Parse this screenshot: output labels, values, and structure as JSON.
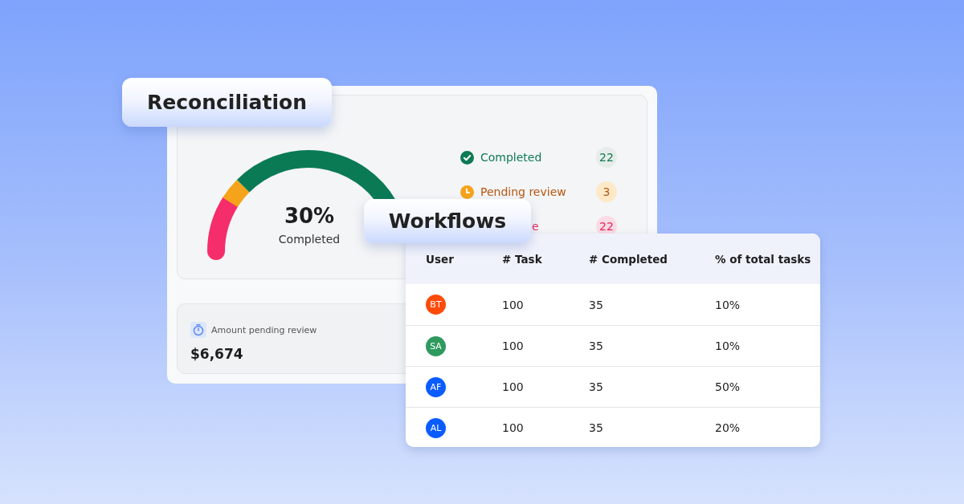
{
  "reconciliation": {
    "title": "Reconciliation",
    "gauge": {
      "value": "30%",
      "caption": "Completed"
    },
    "legend": [
      {
        "kind": "completed",
        "label": "Completed",
        "count": "22",
        "color": "#0f7a55"
      },
      {
        "kind": "pending",
        "label": "Pending review",
        "count": "3",
        "color": "#b5570f"
      },
      {
        "kind": "partial",
        "label": "e",
        "count": "22",
        "color": "#e8265f"
      }
    ],
    "amount": {
      "label": "Amount pending review",
      "value": "$6,674"
    }
  },
  "workflows": {
    "title": "Workflows",
    "table": {
      "columns": [
        "User",
        "# Task",
        "# Completed",
        "% of total tasks"
      ],
      "rows": [
        {
          "initials": "BT",
          "color": "#ff4a0a",
          "task": "100",
          "completed": "35",
          "share": "10%"
        },
        {
          "initials": "SA",
          "color": "#2e9a5e",
          "task": "100",
          "completed": "35",
          "share": "10%"
        },
        {
          "initials": "AF",
          "color": "#0a5cff",
          "task": "100",
          "completed": "35",
          "share": "50%"
        },
        {
          "initials": "AL",
          "color": "#0a5cff",
          "task": "100",
          "completed": "35",
          "share": "20%"
        }
      ]
    }
  }
}
